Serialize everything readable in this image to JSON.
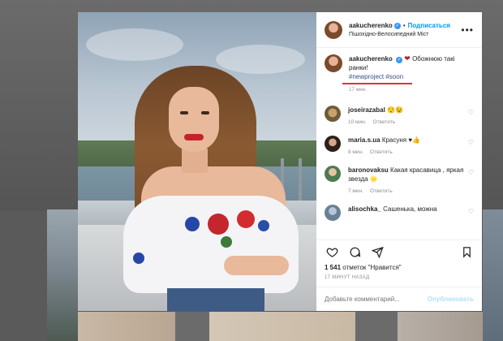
{
  "post": {
    "author": {
      "username": "aakucherenko",
      "follow_label": "Подписаться",
      "location": "Пішохідно-Велосипедний Міст"
    },
    "more_icon": "more-horizontal-icon",
    "caption": {
      "username": "aakucherenko",
      "text": "Обожнюю такі ранки!",
      "hashtags": "#newproject #soon",
      "time": "17 мин."
    },
    "comments": [
      {
        "username": "joseirazabal",
        "text": "😌😉",
        "time": "10 мин.",
        "reply_label": "Ответить"
      },
      {
        "username": "maria.s.ua",
        "text": "Красуня ♥👍",
        "time": "8 мин.",
        "reply_label": "Ответить"
      },
      {
        "username": "baronovaksu",
        "text": "Какая красавица , яркая звезда 🌟",
        "time": "7 мин.",
        "reply_label": "Ответить"
      },
      {
        "username": "alisochka_",
        "text": "Сашенька, можна",
        "time": "",
        "reply_label": ""
      }
    ],
    "likes_count": "1 541",
    "likes_rest": "отметок \"Нравится\"",
    "posted_time": "17 МИНУТ НАЗАД",
    "add_comment_placeholder": "Добавьте комментарий...",
    "publish_label": "Опубликовать"
  },
  "colors": {
    "accent": "#0095f6",
    "verified": "#3897f0",
    "underline": "#e0332c",
    "heart": "#c21a2a"
  }
}
